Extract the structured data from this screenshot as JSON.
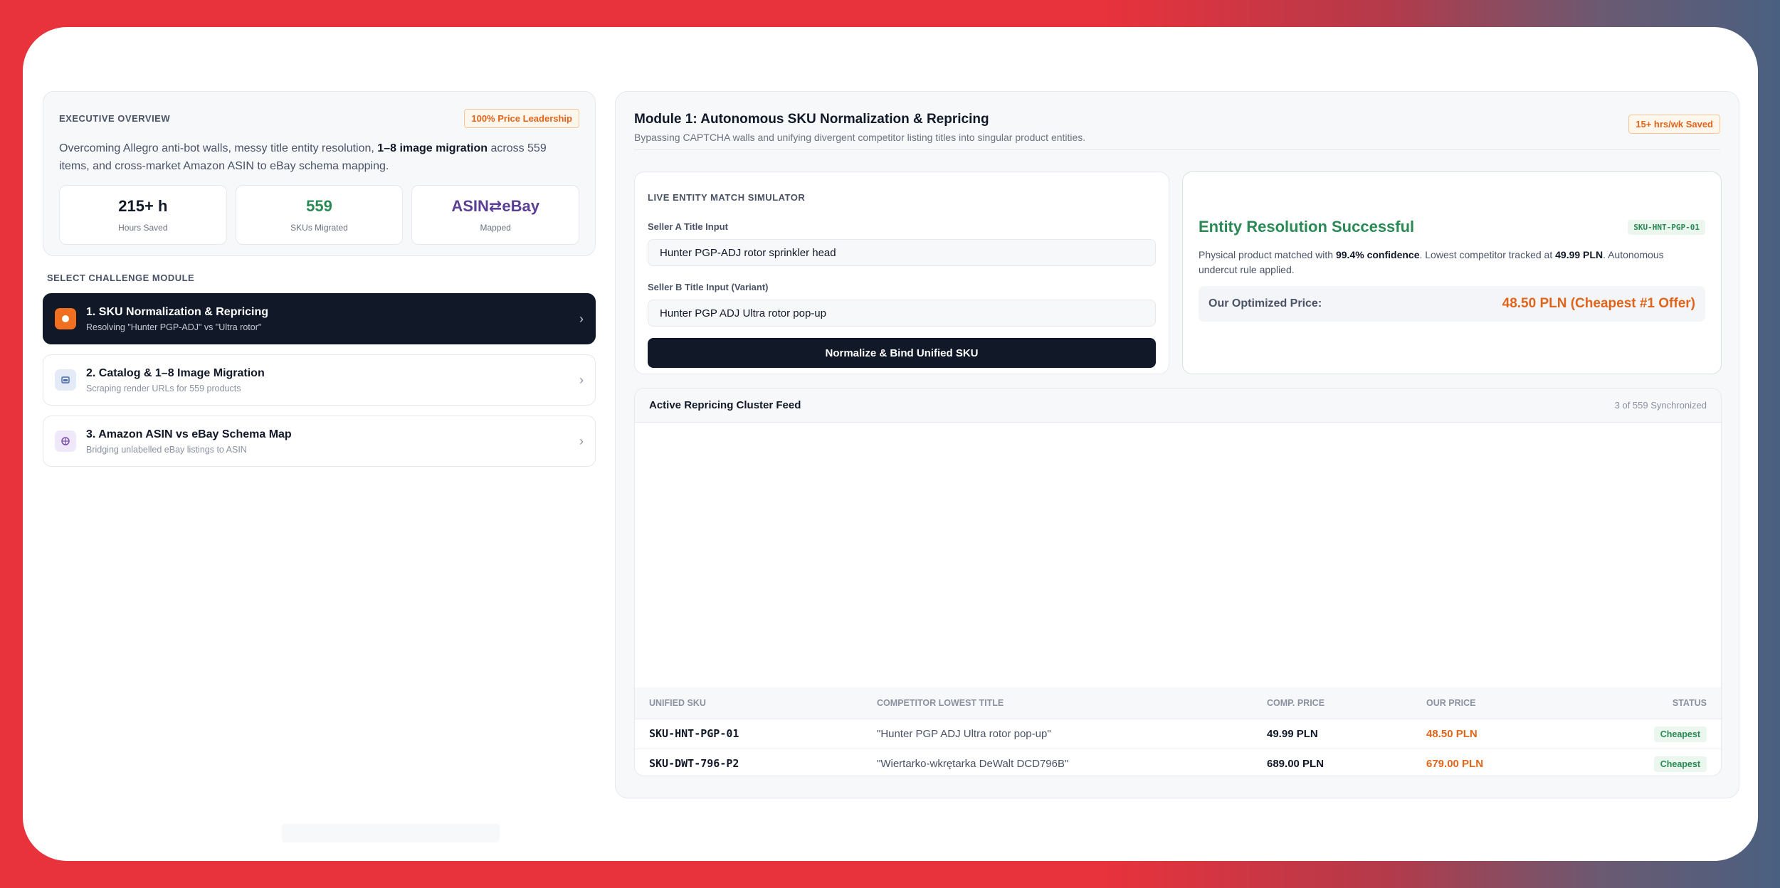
{
  "executive": {
    "eyebrow": "EXECUTIVE OVERVIEW",
    "badge": "100% Price Leadership",
    "desc_pre": "Overcoming Allegro anti-bot walls, messy title entity resolution, ",
    "desc_bold": "1–8 image migration",
    "desc_post": " across 559 items, and cross-market Amazon ASIN to eBay schema mapping.",
    "stats": [
      {
        "value": "215+ h",
        "label": "Hours Saved"
      },
      {
        "value": "559",
        "label": "SKUs Migrated"
      },
      {
        "value": "ASIN⇄eBay",
        "label": "Mapped"
      }
    ]
  },
  "modules": {
    "section_label": "SELECT CHALLENGE MODULE",
    "items": [
      {
        "title": "1. SKU Normalization & Repricing",
        "subtitle": "Resolving \"Hunter PGP-ADJ\" vs \"Ultra rotor\""
      },
      {
        "title": "2. Catalog & 1–8 Image Migration",
        "subtitle": "Scraping render URLs for 559 products"
      },
      {
        "title": "3. Amazon ASIN vs eBay Schema Map",
        "subtitle": "Bridging unlabelled eBay listings to ASIN"
      }
    ]
  },
  "main": {
    "title": "Module 1: Autonomous SKU Normalization & Repricing",
    "subtitle": "Bypassing CAPTCHA walls and unifying divergent competitor listing titles into singular product entities.",
    "badge": "15+ hrs/wk Saved"
  },
  "simulator": {
    "eyebrow": "LIVE ENTITY MATCH SIMULATOR",
    "seller_a_label": "Seller A Title Input",
    "seller_a_value": "Hunter PGP-ADJ rotor sprinkler head",
    "seller_b_label": "Seller B Title Input (Variant)",
    "seller_b_value": "Hunter PGP ADJ Ultra rotor pop-up",
    "button": "Normalize & Bind Unified SKU"
  },
  "result": {
    "title": "Entity Resolution Successful",
    "sku_badge": "SKU-HNT-PGP-01",
    "desc_pre": "Physical product matched with ",
    "desc_conf": "99.4% confidence",
    "desc_mid": ". Lowest competitor tracked at ",
    "desc_price": "49.99 PLN",
    "desc_post": ". Autonomous undercut rule applied.",
    "price_label": "Our Optimized Price:",
    "price_value": "48.50 PLN (Cheapest #1 Offer)"
  },
  "feed": {
    "title": "Active Repricing Cluster Feed",
    "count": "3 of 559 Synchronized",
    "columns": [
      "UNIFIED SKU",
      "COMPETITOR LOWEST TITLE",
      "COMP. PRICE",
      "OUR PRICE",
      "STATUS"
    ],
    "rows": [
      {
        "sku": "SKU-HNT-PGP-01",
        "title": "\"Hunter PGP ADJ Ultra rotor pop-up\"",
        "comp_price": "49.99 PLN",
        "our_price": "48.50 PLN",
        "status": "Cheapest"
      },
      {
        "sku": "SKU-DWT-796-P2",
        "title": "\"Wiertarko-wkrętarka DeWalt DCD796B\"",
        "comp_price": "689.00 PLN",
        "our_price": "679.00 PLN",
        "status": "Cheapest"
      }
    ]
  },
  "colors": {
    "accent_orange": "#e0651b",
    "success_green": "#2a8a55",
    "dark": "#111827",
    "background_red": "#e8323c"
  },
  "icons": [
    "bolt-icon",
    "image-icon",
    "globe-icon",
    "chevron-right-icon"
  ]
}
